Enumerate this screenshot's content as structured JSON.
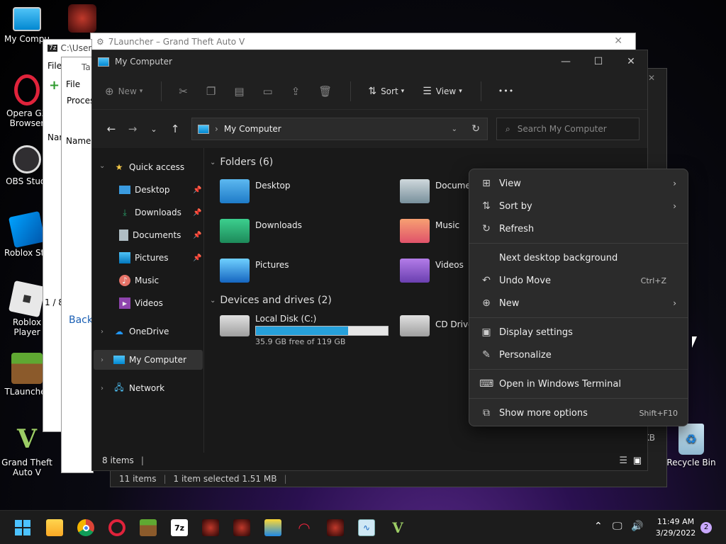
{
  "desktop": {
    "icons": [
      {
        "label": "My Compu",
        "icon": "monitor-icon"
      },
      {
        "label": "Opera GX\nBrowser",
        "icon": "opera-icon"
      },
      {
        "label": "OBS Studi",
        "icon": "obs-icon"
      },
      {
        "label": "Roblox Stu",
        "icon": "roblox-studio-icon"
      },
      {
        "label": "Roblox Player",
        "icon": "roblox-icon"
      },
      {
        "label": "TLauncher",
        "icon": "minecraft-icon"
      },
      {
        "label": "Grand Theft\nAuto V",
        "icon": "gta-icon"
      },
      {
        "label": "Recycle Bin",
        "icon": "recycle-bin-icon"
      }
    ]
  },
  "background_windows": {
    "tlauncher_title": "7Launcher – Grand Theft Auto V",
    "sevenzip": {
      "path": "C:\\User",
      "menu": "File",
      "toolbar": "Ad",
      "col": "Nar",
      "status": "1 / 8",
      "bottom": "F"
    },
    "taskmgr": {
      "menu": "File",
      "tab": "Proces",
      "col": "Name",
      "link": "Back",
      "tab_top": "Ta"
    },
    "dark_status": {
      "items": "11 items",
      "selected": "1 item selected  1.51 MB",
      "size_fragment": "KB"
    }
  },
  "explorer": {
    "title": "My Computer",
    "toolbar": {
      "new": "New",
      "sort": "Sort",
      "view": "View",
      "more": "•••"
    },
    "address": "My Computer",
    "search_placeholder": "Search My Computer",
    "sidebar": {
      "quick_access": "Quick access",
      "items": [
        "Desktop",
        "Downloads",
        "Documents",
        "Pictures",
        "Music",
        "Videos"
      ],
      "onedrive": "OneDrive",
      "my_computer": "My Computer",
      "network": "Network"
    },
    "folders_header": "Folders (6)",
    "folders": [
      "Desktop",
      "Documents",
      "Downloads",
      "Music",
      "Pictures",
      "Videos"
    ],
    "folders_visible": [
      "Desktop",
      "Docume",
      "Downloads",
      "Music",
      "Pictures",
      "Videos"
    ],
    "drives_header": "Devices and drives (2)",
    "drives": [
      {
        "name": "Local Disk (C:)",
        "free": "35.9 GB free of 119 GB",
        "used_fraction": 0.7
      },
      {
        "name": "CD Drive"
      }
    ],
    "status": "8 items"
  },
  "context_menu": {
    "items": [
      {
        "label": "View",
        "icon": "grid-icon",
        "submenu": true
      },
      {
        "label": "Sort by",
        "icon": "sort-icon",
        "submenu": true
      },
      {
        "label": "Refresh",
        "icon": "refresh-icon"
      },
      {
        "label": "Next desktop background"
      },
      {
        "label": "Undo Move",
        "icon": "undo-icon",
        "shortcut": "Ctrl+Z"
      },
      {
        "label": "New",
        "icon": "plus-circle-icon",
        "submenu": true
      },
      {
        "label": "Display settings",
        "icon": "display-icon"
      },
      {
        "label": "Personalize",
        "icon": "brush-icon"
      },
      {
        "label": "Open in Windows Terminal",
        "icon": "terminal-icon"
      },
      {
        "label": "Show more options",
        "icon": "more-options-icon",
        "shortcut": "Shift+F10"
      }
    ]
  },
  "taskbar": {
    "time": "11:49 AM",
    "date": "3/29/2022",
    "notifications": "2",
    "sevenzip_label": "7z"
  },
  "colors": {
    "accent": "#0078d4",
    "drive_bar": "#26a0da",
    "folder_blue": "#3a9be0",
    "folder_green": "#2aa36a"
  }
}
